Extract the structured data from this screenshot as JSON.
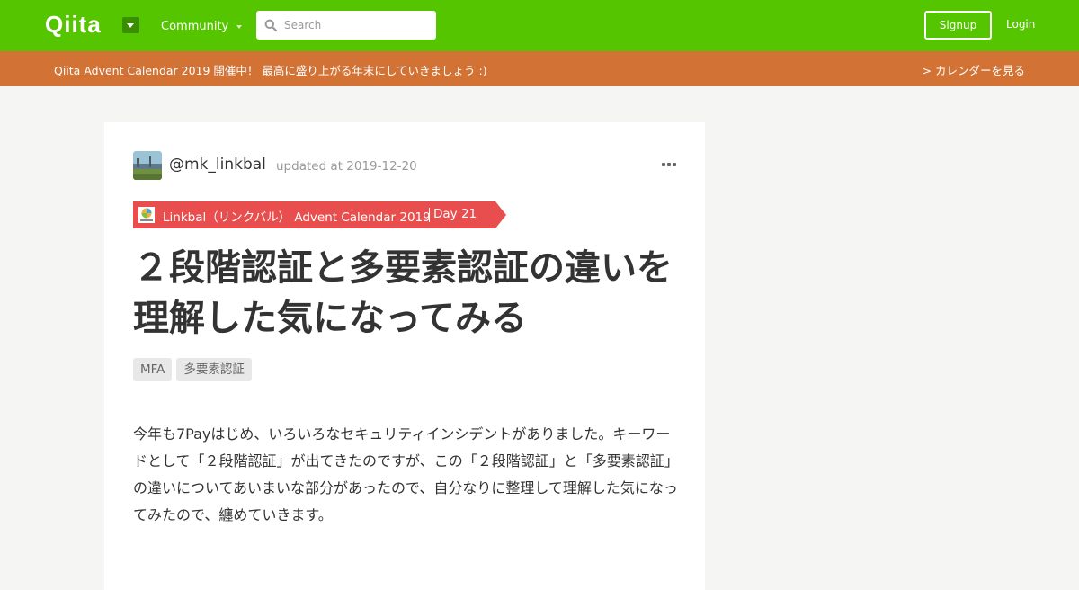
{
  "header": {
    "logo": "Qiita",
    "community_label": "Community",
    "search_placeholder": "Search",
    "signup_label": "Signup",
    "login_label": "Login"
  },
  "banner": {
    "text": "Qiita Advent Calendar 2019 開催中！ 最高に盛り上がる年末にしていきましょう :)",
    "link_label": "> カレンダーを見る"
  },
  "article": {
    "author": "@mk_linkbal",
    "updated": "updated at 2019-12-20",
    "calendar_name": "Linkbal（リンクバル） Advent Calendar 2019",
    "calendar_day": "Day 21",
    "title": "２段階認証と多要素認証の違いを理解した気になってみる",
    "tags": [
      "MFA",
      "多要素認証"
    ],
    "body": "今年も7Payはじめ、いろいろなセキュリティインシデントがありました。キーワードとして「２段階認証」が出てきたのですが、この「２段階認証」と「多要素認証」の違いについてあいまいな部分があったので、自分なりに整理して理解した気になってみたので、纏めていきます。"
  },
  "colors": {
    "brand": "#55c500",
    "banner": "#d27335",
    "ribbon": "#e94e4e"
  }
}
